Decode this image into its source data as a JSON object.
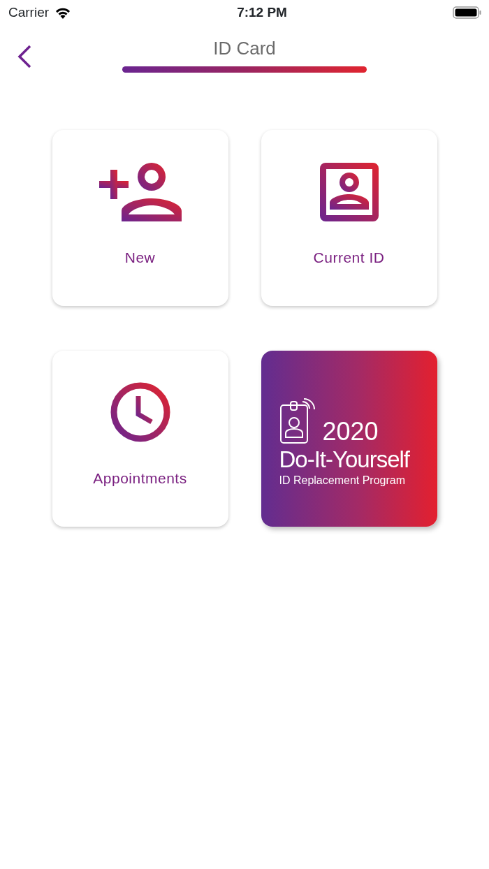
{
  "status_bar": {
    "carrier": "Carrier",
    "time": "7:12 PM"
  },
  "nav": {
    "title": "ID Card"
  },
  "tiles": [
    {
      "label": "New"
    },
    {
      "label": "Current ID"
    },
    {
      "label": "Appointments"
    }
  ],
  "promo_banner": {
    "year": "2020",
    "title": "Do-It-Yourself",
    "subtitle": "ID Replacement Program"
  }
}
